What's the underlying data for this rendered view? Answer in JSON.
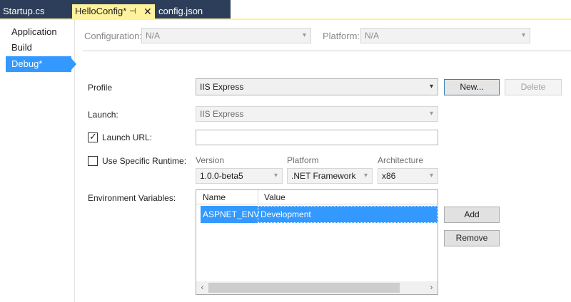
{
  "tabs": [
    {
      "label": "Startup.cs"
    },
    {
      "label": "HelloConfig*"
    },
    {
      "label": "config.json"
    }
  ],
  "tab_icons": {
    "pin": "pin-icon",
    "close": "close-icon"
  },
  "nav": {
    "items": [
      {
        "label": "Application"
      },
      {
        "label": "Build"
      },
      {
        "label": "Debug*"
      }
    ]
  },
  "config_bar": {
    "configuration_label": "Configuration:",
    "configuration_value": "N/A",
    "platform_label": "Platform:",
    "platform_value": "N/A"
  },
  "profile": {
    "label": "Profile",
    "value": "IIS Express",
    "new_button": "New...",
    "delete_button": "Delete"
  },
  "launch": {
    "label": "Launch:",
    "value": "IIS Express"
  },
  "launch_url": {
    "label": "Launch URL:",
    "checked": true,
    "value": ""
  },
  "runtime": {
    "label": "Use Specific Runtime:",
    "checked": false,
    "version_label": "Version",
    "version_value": "1.0.0-beta5",
    "platform_label": "Platform",
    "platform_value": ".NET Framework",
    "architecture_label": "Architecture",
    "architecture_value": "x86"
  },
  "env": {
    "label": "Environment Variables:",
    "columns": [
      "Name",
      "Value"
    ],
    "rows": [
      {
        "name": "ASPNET_ENV",
        "value": "Development"
      }
    ],
    "add_button": "Add",
    "remove_button": "Remove"
  },
  "colors": {
    "accent": "#3399ff",
    "tab_active": "#fff29d",
    "tab_strip": "#2d3e5a"
  }
}
